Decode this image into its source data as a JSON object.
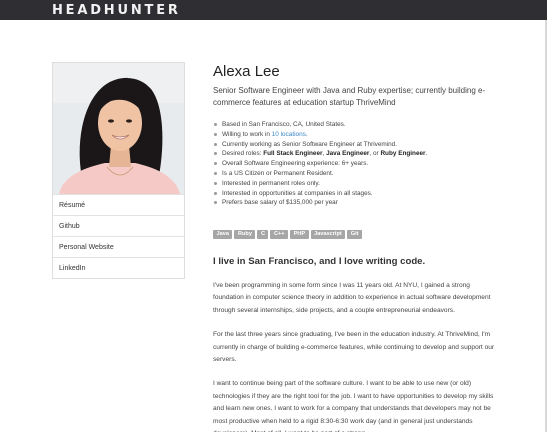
{
  "header": {
    "brand": "HEADHUNTER"
  },
  "profile": {
    "name": "Alexa Lee",
    "tagline": "Senior Software Engineer with Java and Ruby expertise; currently building e-commerce features at education startup ThriveMind"
  },
  "sidebar": {
    "links": [
      "Résumé",
      "Github",
      "Personal Website",
      "LinkedIn"
    ]
  },
  "facts": {
    "location_prefix": "Based in ",
    "location": "San Francisco, CA, United States.",
    "willing_prefix": "Willing to work in ",
    "willing_link": "10 locations",
    "willing_suffix": ".",
    "current_prefix": "Currently working as ",
    "current_role": "Senior Software Engineer at Thrivemind",
    "current_suffix": ".",
    "desired_prefix": "Desired roles: ",
    "desired_1": "Full Stack Engineer",
    "desired_sep1": ", ",
    "desired_2": "Java Engineer",
    "desired_sep2": ", or ",
    "desired_3": "Ruby Engineer",
    "desired_suffix": ".",
    "experience_prefix": "Overall Software Engineering experience: ",
    "experience": "6+ years",
    "experience_suffix": ".",
    "citizenship": "Is a US Citizen or Permanent Resident.",
    "permanent": "Interested in permanent roles only.",
    "stages": "Interested in opportunities at companies in all stages.",
    "salary_prefix": "Prefers base salary of ",
    "salary": "$135,000",
    "salary_suffix": " per year"
  },
  "skills": [
    "Java",
    "Ruby",
    "C",
    "C++",
    "PHP",
    "Javascript",
    "Git"
  ],
  "bio": {
    "headline": "I live in San Francisco, and I love writing code.",
    "paragraphs": [
      "I've been programming in some form since I was 11 years old. At NYU, I gained a strong foundation in computer science theory in addition to experience in actual software development through several internships, side projects, and a couple entrepreneurial endeavors.",
      "For the last three years since graduating, I've been in the education industry. At ThriveMind, I'm currently in charge of building e-commerce features, while continuing to develop and support our servers.",
      "I want to continue being part of the software culture. I want to be able to use new (or old) technologies if they are the right tool for the job. I want to have opportunities to develop my skills and learn new ones. I want to work for a company that understands that developers may not be most productive when held to a rigid 8:30-6:30 work day (and in general just understands developers). Most of all, I want to be part of a strong"
    ]
  },
  "colors": {
    "topbar": "#2e2e33",
    "link": "#3a86c8",
    "skill_tag": "#a6a6a6"
  }
}
